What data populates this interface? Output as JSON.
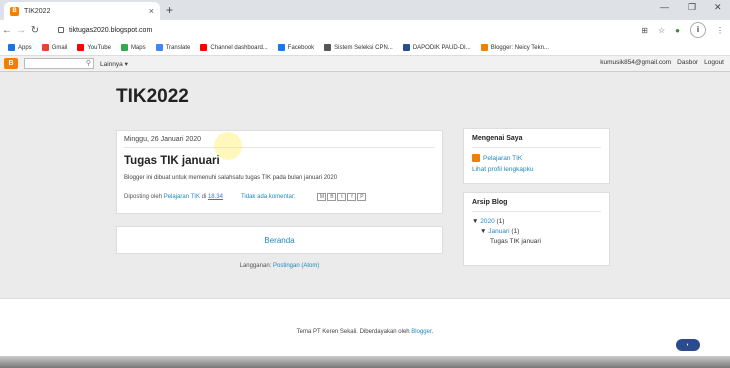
{
  "browser": {
    "tab_title": "TIK2022",
    "tab_close": "×",
    "new_tab": "+",
    "url": "tiktugas2020.blogspot.com",
    "profile": "i",
    "bookmarks": [
      {
        "label": "Apps",
        "color": "#1a73e8"
      },
      {
        "label": "Gmail",
        "color": "#ea4335"
      },
      {
        "label": "YouTube",
        "color": "#ff0000"
      },
      {
        "label": "Maps",
        "color": "#34a853"
      },
      {
        "label": "Translate",
        "color": "#4285f4"
      },
      {
        "label": "Channel dashboard...",
        "color": "#ff0000"
      },
      {
        "label": "Facebook",
        "color": "#1877f2"
      },
      {
        "label": "Sistem Seleksi CPN...",
        "color": "#555555"
      },
      {
        "label": "DAPODIK PAUD-DI...",
        "color": "#2b4b8c"
      },
      {
        "label": "Blogger: Neicy Tekn...",
        "color": "#f57d00"
      }
    ]
  },
  "blogger_nav": {
    "logo": "B",
    "more": "Lainnya ▾",
    "email": "kumusik854@gmail.com",
    "dashboard": "Dasbor",
    "logout": "Logout"
  },
  "blog": {
    "title": "TIK2022",
    "post": {
      "date": "Minggu, 26 Januari 2020",
      "title": "Tugas TIK januari",
      "body": "Blogger ini dibuat untuk memenuhi salahsatu tugas TIK pada bulan januari 2020",
      "posted_by": "Diposting oleh",
      "author": "Pelajaran TIK",
      "at": "di",
      "time": "18.34",
      "comments": "Tidak ada komentar:"
    },
    "home": "Beranda",
    "subscribe_label": "Langganan:",
    "subscribe_link": "Postingan (Atom)"
  },
  "sidebar": {
    "about_title": "Mengenai Saya",
    "profile_name": "Pelajaran TIK",
    "profile_link": "Lihat profil lengkapku",
    "archive_title": "Arsip Blog",
    "year": "2020",
    "year_count": "(1)",
    "month": "Januari",
    "month_count": "(1)",
    "post_link": "Tugas TIK januari"
  },
  "footer": {
    "text": "Tema PT Keren Sekali. Diberdayakan oleh",
    "link": "Blogger",
    "end": "."
  }
}
